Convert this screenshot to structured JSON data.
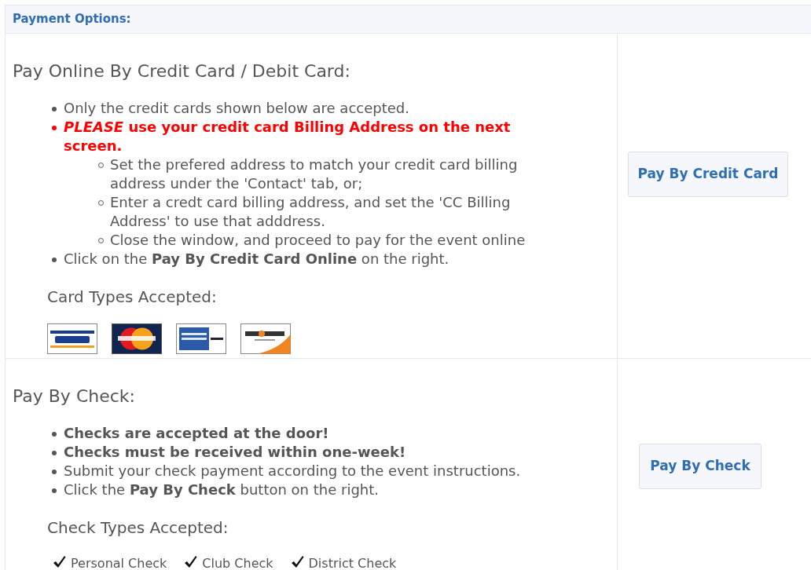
{
  "header": {
    "title": "Payment Options:"
  },
  "sections": [
    {
      "title": "Pay Online By Credit Card / Debit Card:",
      "bullets": [
        {
          "kind": "plain",
          "text": "Only the credit cards shown below are accepted."
        },
        {
          "kind": "alert",
          "text": "*PLEASE* use your credit card Billing Address on the next screen.",
          "children": [
            {
              "text": "Set the prefered address to match your credit card billing address under the 'Contact' tab, or;"
            },
            {
              "text": "Enter a credt card billing address, and set the 'CC Billing Address' to use that adddress."
            },
            {
              "text": "Close the window, and proceed to pay for the event online"
            }
          ]
        },
        {
          "kind": "plain",
          "text": "Click on the **Pay By Credit Card Online** on the right."
        }
      ],
      "accepted_label": "Card Types Accepted:",
      "cards": [
        {
          "kind": "visa"
        },
        {
          "kind": "mastercard"
        },
        {
          "kind": "amex"
        },
        {
          "kind": "discover"
        }
      ],
      "button": "Pay By Credit Card"
    },
    {
      "title": "Pay By Check:",
      "bullets": [
        {
          "kind": "bold",
          "text": "Checks are accepted at the door!"
        },
        {
          "kind": "bold",
          "text": "Checks must be received within one-week!"
        },
        {
          "kind": "plain",
          "text": "Submit your check payment according to the event instructions."
        },
        {
          "kind": "plain",
          "text": "Click the **Pay By Check** button on the right."
        }
      ],
      "accepted_label": "Check Types Accepted:",
      "check_types": [
        {
          "label": "Personal Check"
        },
        {
          "label": "Club Check"
        },
        {
          "label": "District Check"
        }
      ],
      "button": "Pay By Check"
    }
  ]
}
